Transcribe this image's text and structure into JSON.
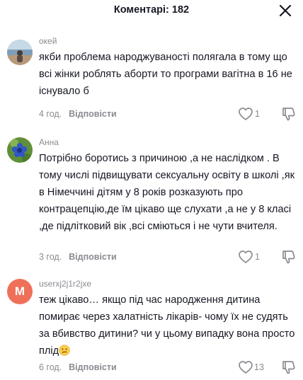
{
  "header": {
    "title": "Коментарі: 182"
  },
  "comments": [
    {
      "username": "окей",
      "text": "якби проблема народжуваності полягала в тому що всі жінки роблять аборти то програми вагітна в 16 не існувало б",
      "time": "4 год.",
      "reply": "Відповісти",
      "likes": "1",
      "avatar": "photo-beach"
    },
    {
      "username": "Анна",
      "text": "Потрібно боротись з причиною ,а не наслідком . В тому числі підвищувати сексуальну освіту в школі ,як в Німеччині дітям у 8 років розказують про контрацепцію,де їм цікаво ще слухати ,а не у 8 класі ,де підлітковий вік ,всі сміються і не чути вчителя.",
      "time": "3 год.",
      "reply": "Відповісти",
      "likes": "1",
      "avatar": "photo-flowers"
    },
    {
      "username": "userxj2j1r2jxe",
      "text": "теж цікаво… якщо під час народження дитина помирає через халатність лікарів- чому їх не судять за вбивство дитини? чи у цьому випадку вона просто плід",
      "time": "6 год.",
      "reply": "Відповісти",
      "likes": "13",
      "avatar_letter": "M",
      "avatar_color": "#ef7058",
      "emoji": "confused-face-icon"
    }
  ],
  "colors": {
    "secondary_text": "#8a8b91",
    "primary_text": "#161823"
  }
}
